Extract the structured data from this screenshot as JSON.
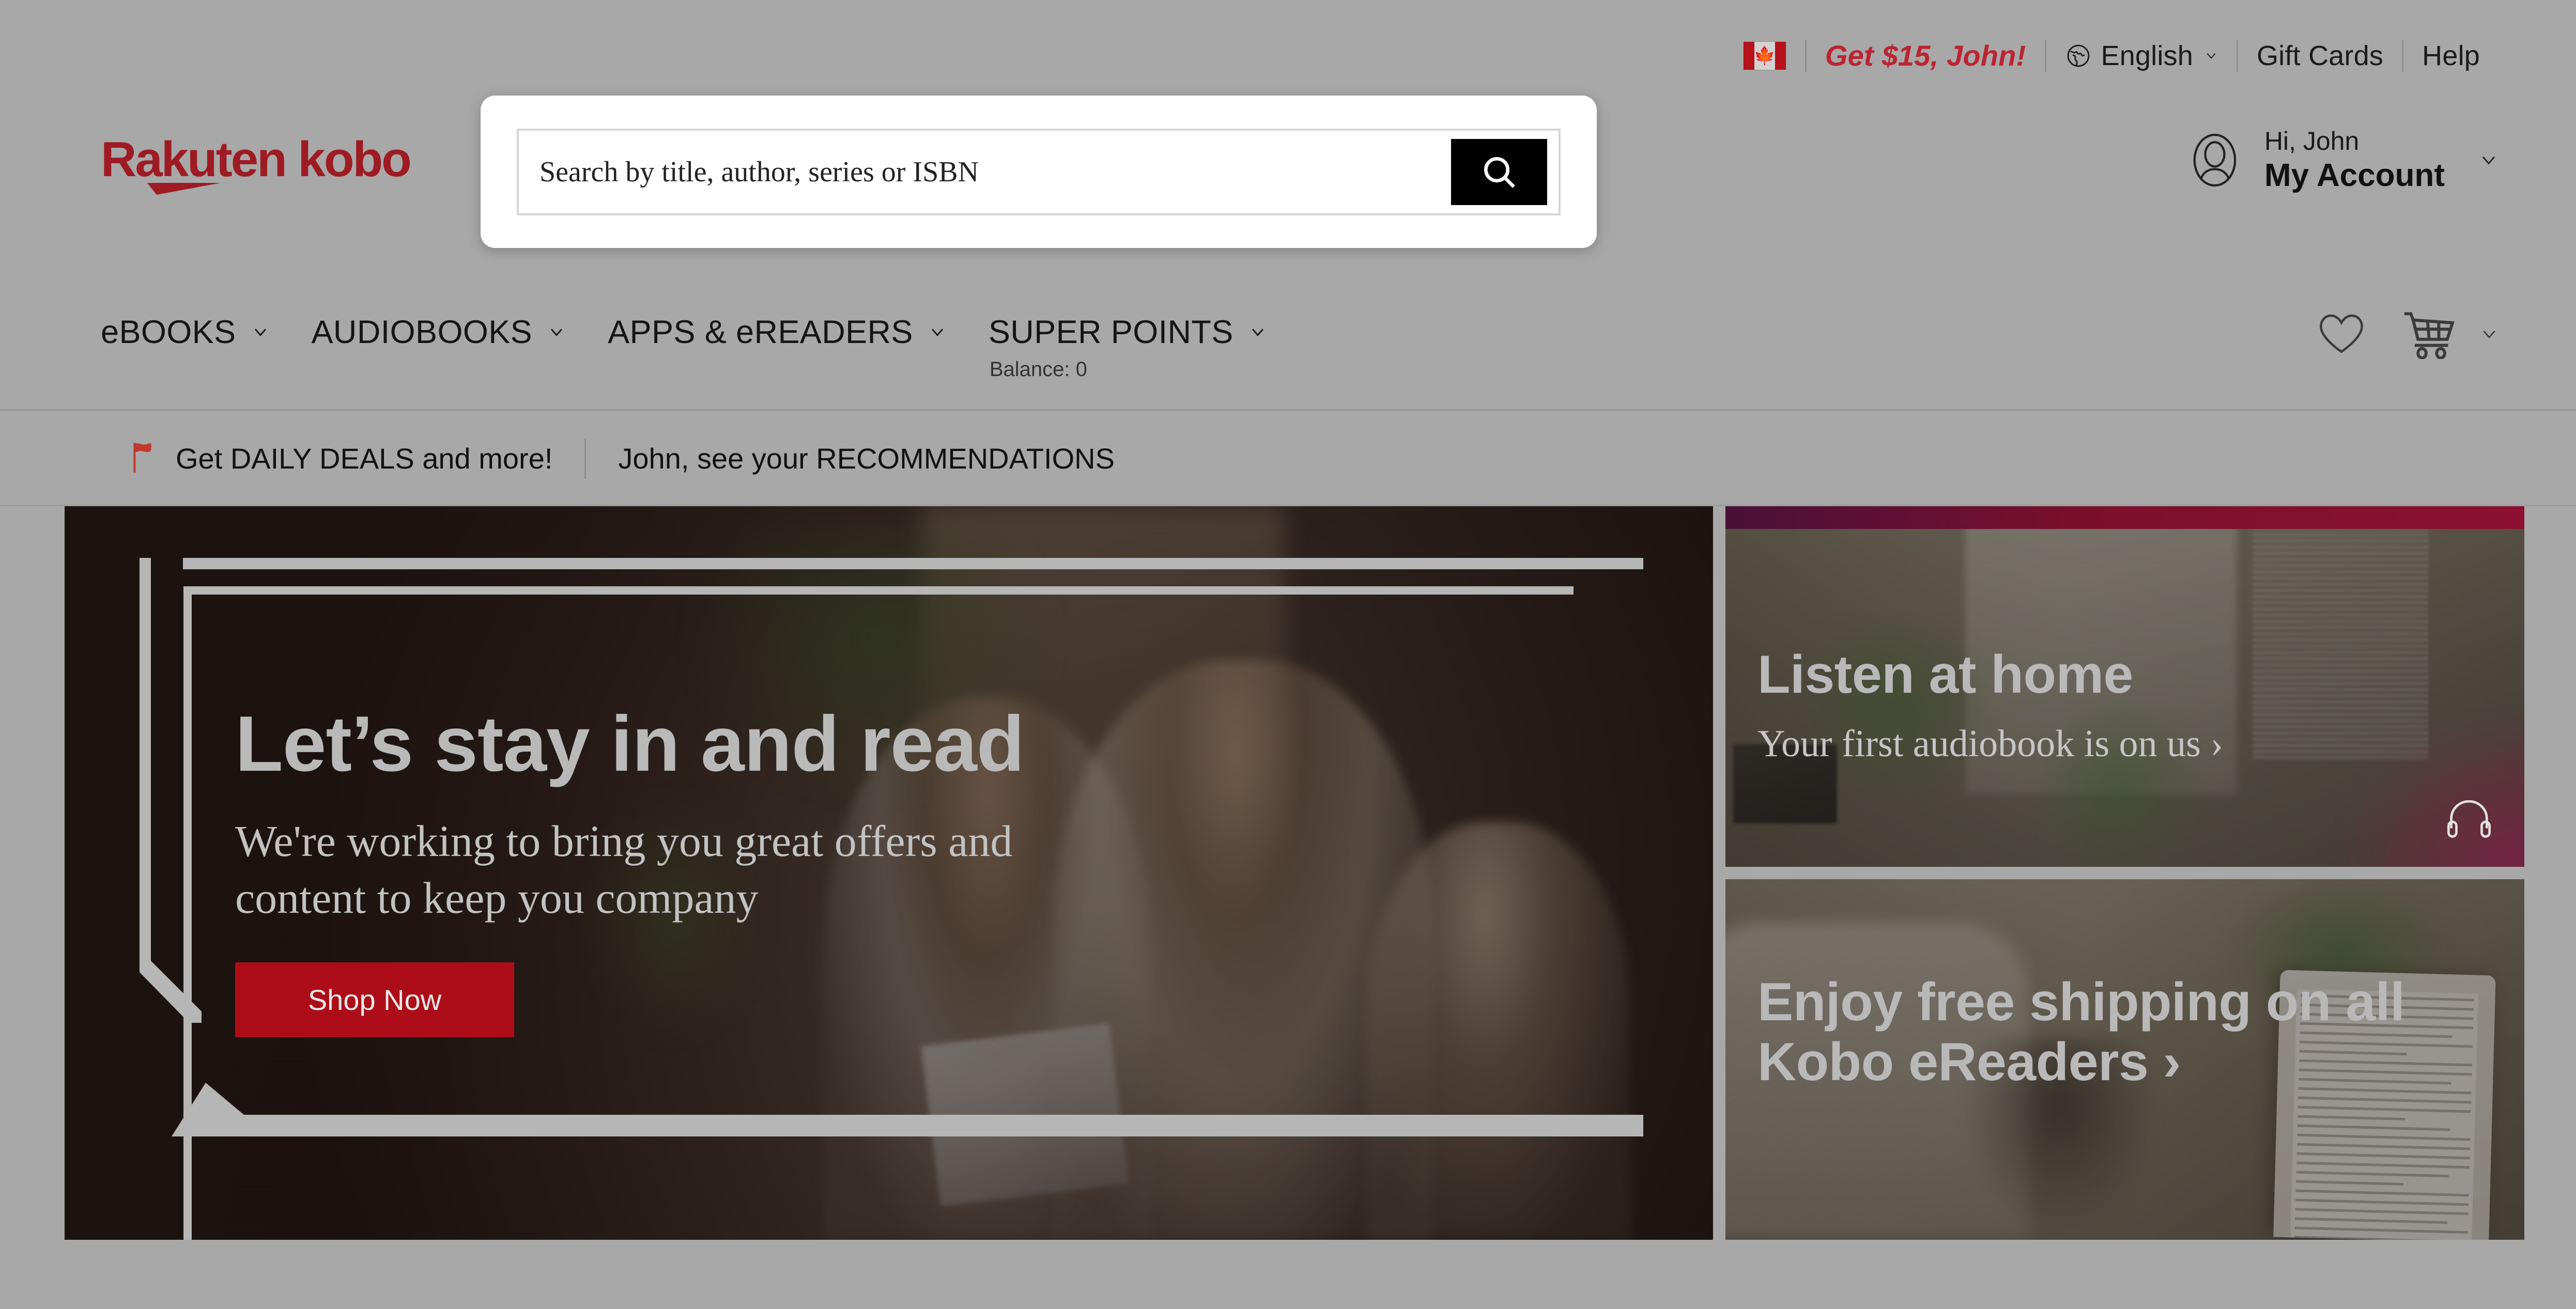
{
  "topbar": {
    "flag": "canada-flag",
    "promo_label": "Get $15, John!",
    "language_label": "English",
    "gift_cards_label": "Gift Cards",
    "help_label": "Help",
    "globe_icon": "globe-icon",
    "chevron_icon": "chevron-down-icon"
  },
  "header": {
    "logo_text": "Rakuten kobo",
    "account": {
      "greeting": "Hi, John",
      "label": "My Account",
      "avatar_icon": "avatar-icon",
      "chevron_icon": "chevron-down-icon"
    }
  },
  "search": {
    "placeholder": "Search by title, author, series or ISBN",
    "value": "",
    "button_icon": "search-icon"
  },
  "nav": {
    "items": [
      {
        "label": "eBOOKS",
        "sub": ""
      },
      {
        "label": "AUDIOBOOKS",
        "sub": ""
      },
      {
        "label": "APPS & eREADERS",
        "sub": ""
      },
      {
        "label": "SUPER POINTS",
        "sub": "Balance: 0"
      }
    ],
    "wishlist_icon": "heart-icon",
    "cart_icon": "shopping-cart-icon",
    "cart_chevron": "chevron-down-icon"
  },
  "promostrip": {
    "flag_icon": "red-flag-icon",
    "deals_label": "Get DAILY DEALS and more!",
    "recommendations_label": "John, see your RECOMMENDATIONS"
  },
  "hero": {
    "title": "Let’s stay in and read",
    "subtitle": "We're working to bring you great offers and content to keep you company",
    "cta_label": "Shop Now"
  },
  "promo_cards": [
    {
      "title": "Listen at home",
      "subtitle": "Your first audiobook is on us ›",
      "icon": "headphones-icon"
    },
    {
      "title": "Enjoy free shipping on all Kobo eReaders ›",
      "subtitle": ""
    }
  ],
  "colors": {
    "brand_red": "#bb2432",
    "cta_red": "#ad0d18",
    "page_bg": "#a8a8a8",
    "accent_magenta": "#8d1031"
  }
}
